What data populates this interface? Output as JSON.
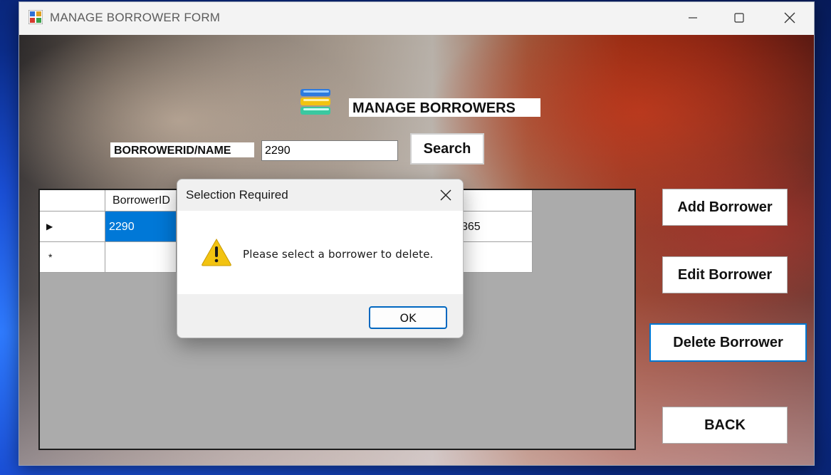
{
  "window": {
    "title": "MANAGE BORROWER FORM",
    "icon": "form-app-icon",
    "controls": [
      "minimize-icon",
      "maximize-icon",
      "close-icon"
    ]
  },
  "form": {
    "heading": "MANAGE BORROWERS",
    "heading_icon": "books-icon",
    "search": {
      "label": "BORROWERID/NAME",
      "value": "2290",
      "button_label": "Search"
    },
    "buttons": {
      "add": "Add Borrower",
      "edit": "Edit Borrower",
      "delete": "Delete Borrower",
      "back": "BACK"
    }
  },
  "grid": {
    "columns": [
      "BorrowerID"
    ],
    "rows": [
      {
        "marker": "▶",
        "borrower_id": "2290",
        "trailing_fragment": "365",
        "selected": true
      },
      {
        "marker": "*",
        "borrower_id": "",
        "trailing_fragment": "",
        "selected": false
      }
    ],
    "colors": {
      "selection": "#0078d7",
      "empty_area": "#ababab"
    }
  },
  "dialog": {
    "title": "Selection Required",
    "icon": "warning-icon",
    "message": "Please select a borrower to delete.",
    "ok_label": "OK",
    "colors": {
      "ok_border": "#0067c0",
      "warning": "#f2c311"
    }
  }
}
